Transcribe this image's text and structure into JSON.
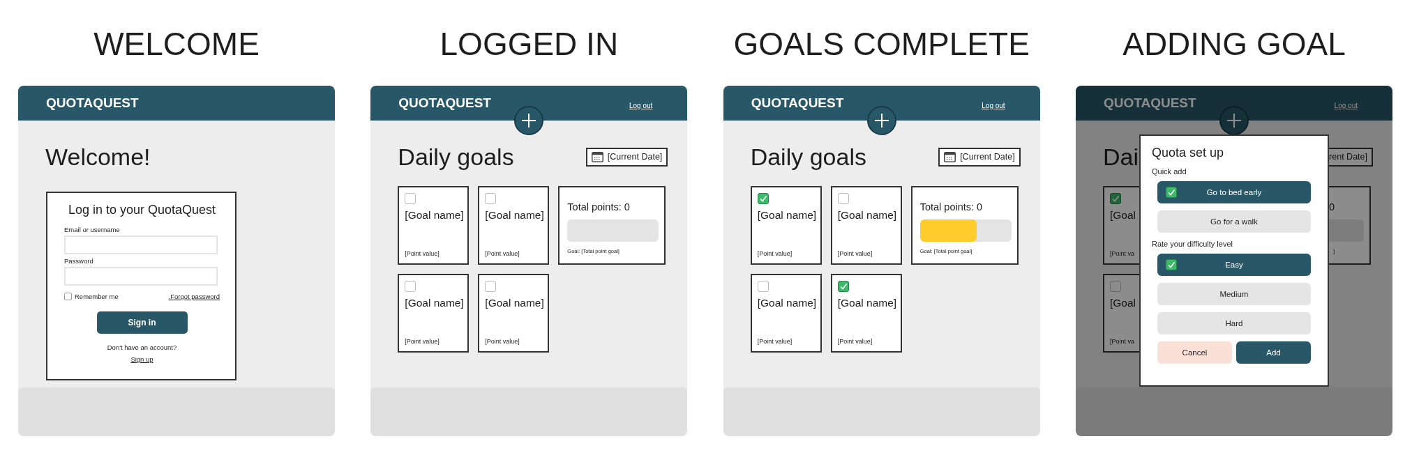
{
  "screens": [
    {
      "kind": "welcome",
      "title": "WELCOME",
      "brand": "QUOTAQUEST",
      "heading": "Welcome!",
      "login": {
        "title": "Log in to your QuotaQuest",
        "email_label": "Email or username",
        "password_label": "Password",
        "remember": {
          "label": "Remember me",
          "checked": false
        },
        "forgot": ".Forgot password",
        "signin": "Sign in",
        "no_account": "Don't have an account?",
        "signup": "Sign up"
      }
    },
    {
      "kind": "dashboard",
      "title": "LOGGED IN",
      "brand": "QUOTAQUEST",
      "logout": "Log out",
      "heading": "Daily goals",
      "date": "[Current Date]",
      "goals": [
        {
          "name": "[Goal name]",
          "points": "[Point value]",
          "checked": false
        },
        {
          "name": "[Goal name]",
          "points": "[Point value]",
          "checked": false
        },
        {
          "name": "[Goal name]",
          "points": "[Point value]",
          "checked": false
        },
        {
          "name": "[Goal name]",
          "points": "[Point value]",
          "checked": false
        }
      ],
      "total": {
        "label": "Total points: 0",
        "goal": "Goal: [Total point goal]"
      }
    },
    {
      "kind": "dashboard",
      "title": "GOALS COMPLETE",
      "brand": "QUOTAQUEST",
      "logout": "Log out",
      "heading": "Daily goals",
      "date": "[Current Date]",
      "goals": [
        {
          "name": "[Goal name]",
          "points": "[Point value]",
          "checked": true
        },
        {
          "name": "[Goal name]",
          "points": "[Point value]",
          "checked": false
        },
        {
          "name": "[Goal name]",
          "points": "[Point value]",
          "checked": false
        },
        {
          "name": "[Goal name]",
          "points": "[Point value]",
          "checked": true
        }
      ],
      "total": {
        "label": "Total points: 0",
        "level": 0.62,
        "goal": "Goal: [Total point goal]"
      }
    },
    {
      "kind": "adding",
      "title": "ADDING GOAL",
      "brand": "QUOTAQUEST",
      "logout": "Log out",
      "heading": "Dai",
      "date": "rent Date]",
      "goals": [
        {
          "name": "[Goal",
          "points": "[Point va",
          "checked": true
        },
        {
          "name": "[Goal",
          "points": "[Point va",
          "checked": false
        }
      ],
      "total": {
        "label": "0",
        "goal": "]"
      },
      "modal": {
        "title": "Quota set up",
        "sections": [
          {
            "label": "Quick add",
            "options": [
              {
                "label": "Go to bed early",
                "selected": true
              },
              {
                "label": "Go for a walk",
                "selected": false
              }
            ]
          },
          {
            "label": "Rate your difficulty level",
            "options": [
              {
                "label": "Easy",
                "selected": true
              },
              {
                "label": "Medium",
                "selected": false
              },
              {
                "label": "Hard",
                "selected": false
              }
            ]
          }
        ],
        "cancel": "Cancel",
        "add": "Add"
      }
    }
  ]
}
